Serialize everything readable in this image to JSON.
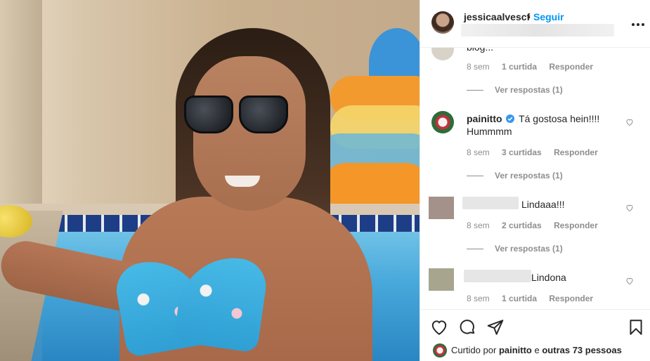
{
  "post": {
    "owner": "jessicaalvescf",
    "dot": "•",
    "follow_label": "Seguir",
    "more_label": "•••"
  },
  "comments": [
    {
      "partial_text": "blog...",
      "time": "8 sem",
      "likes": "1 curtida",
      "reply_label": "Responder",
      "view_replies": "Ver respostas (1)"
    },
    {
      "user": "painitto",
      "verified": true,
      "text": "Tá gostosa hein!!!! Hummmm",
      "time": "8 sem",
      "likes": "3 curtidas",
      "reply_label": "Responder",
      "view_replies": "Ver respostas (1)"
    },
    {
      "text": "Lindaaa!!!",
      "time": "8 sem",
      "likes": "2 curtidas",
      "reply_label": "Responder",
      "view_replies": "Ver respostas (1)"
    },
    {
      "text": "Lindona",
      "time": "8 sem",
      "likes": "1 curtida",
      "reply_label": "Responder"
    }
  ],
  "footer": {
    "liked_prefix": "Curtido por",
    "liked_user": "painitto",
    "liked_middle": "e",
    "liked_others": "outras 73 pessoas"
  },
  "colors": {
    "accent": "#0095f6",
    "text": "#262626",
    "muted": "#8e8e8e",
    "border": "#efefef"
  },
  "icons": [
    "more-options-icon",
    "verified-badge-icon",
    "heart-icon",
    "comment-icon",
    "share-icon",
    "bookmark-icon"
  ]
}
